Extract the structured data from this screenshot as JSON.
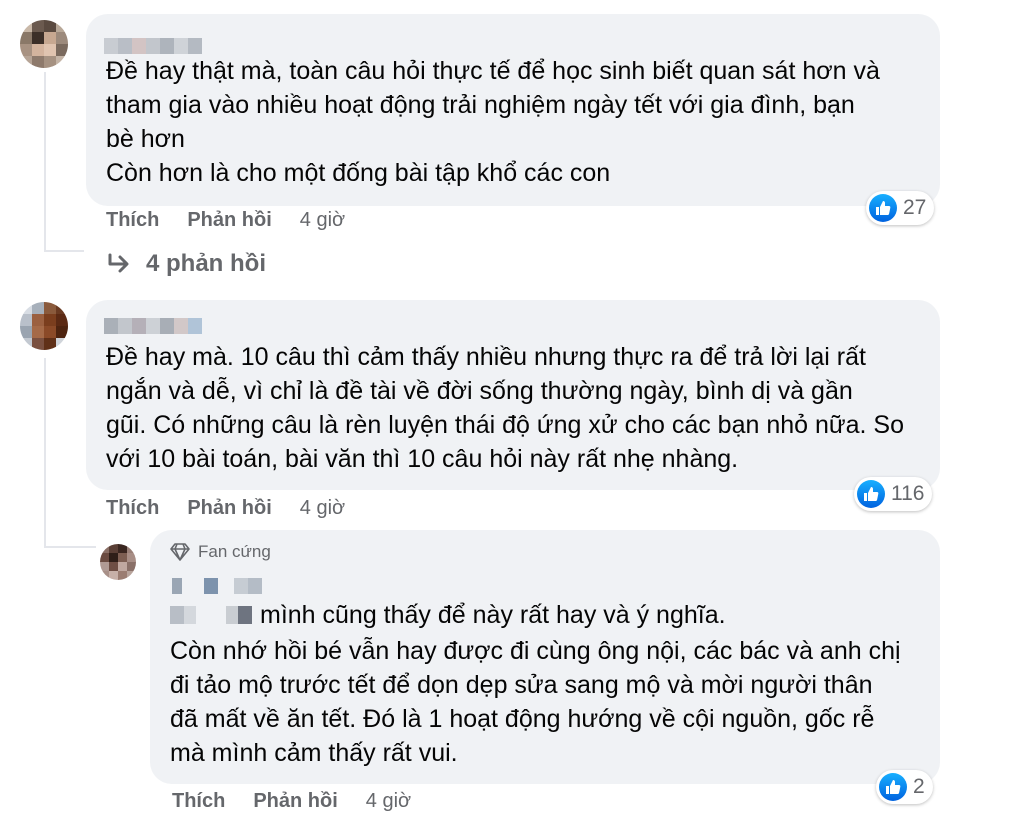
{
  "colors": {
    "bubble_bg": "#f0f2f5",
    "meta_gray": "#65676b",
    "like_blue": "#1877f2",
    "text": "#050505"
  },
  "comments": [
    {
      "text": "Đề hay thật mà, toàn câu hỏi thực tế để học sinh biết quan sát hơn và\ntham gia vào nhiều hoạt động trải nghiệm ngày tết với gia đình, bạn\nbè hơn\nCòn hơn là cho một đống bài tập khổ các con",
      "like_label": "Thích",
      "reply_label": "Phản hồi",
      "time": "4 giờ",
      "reaction_icon": "like-icon",
      "reaction_count": "27",
      "replies_link": "4 phản hồi"
    },
    {
      "text": "Đề hay mà. 10 câu thì cảm thấy nhiều nhưng thực ra để trả lời lại rất\nngắn và dễ, vì chỉ là đề tài về đời sống thường ngày, bình dị và gần\ngũi. Có những câu là rèn luyện thái độ ứng xử cho các bạn nhỏ nữa. So\nvới 10 bài toán, bài văn thì 10 câu hỏi này rất nhẹ nhàng.",
      "like_label": "Thích",
      "reply_label": "Phản hồi",
      "time": "4 giờ",
      "reaction_icon": "like-icon",
      "reaction_count": "116"
    }
  ],
  "reply": {
    "badge_icon": "diamond-icon",
    "badge": "Fan cứng",
    "mention_suffix": "mình cũng thấy để này rất hay và ý nghĩa.",
    "text": "Còn nhớ hồi bé vẫn hay được đi cùng ông nội, các bác và anh chị\nđi tảo mộ trước tết để dọn dẹp sửa sang mộ và mời người thân\nđã mất về ăn tết. Đó là 1 hoạt động hướng về cội nguồn, gốc rễ\nmà mình cảm thấy rất vui.",
    "like_label": "Thích",
    "reply_label": "Phản hồi",
    "time": "4 giờ",
    "reaction_icon": "like-icon",
    "reaction_count": "2"
  }
}
